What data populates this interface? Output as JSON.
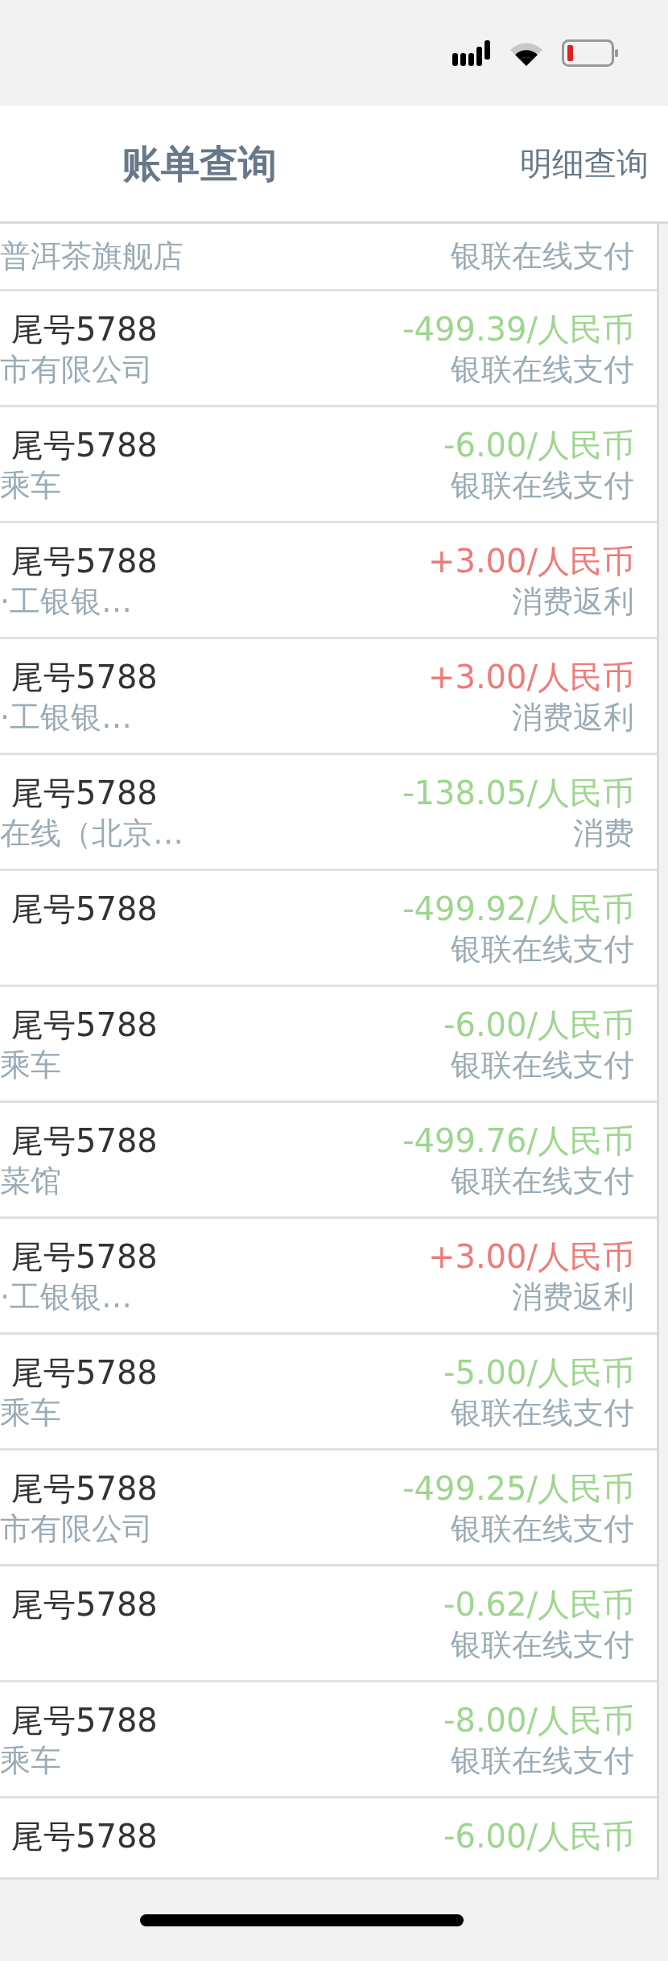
{
  "nav": {
    "title": "账单查询",
    "action": "明细查询"
  },
  "rows": [
    {
      "merchant": "普洱茶旗舰店",
      "type": "银联在线支付"
    },
    {
      "card": "尾号5788",
      "amount": "-499.39/人民币",
      "color": "#9dd68d",
      "merchant": "市有限公司",
      "type": "银联在线支付"
    },
    {
      "card": "尾号5788",
      "amount": "-6.00/人民币",
      "color": "#9dd68d",
      "merchant": "乘车",
      "type": "银联在线支付"
    },
    {
      "card": "尾号5788",
      "amount": "+3.00/人民币",
      "color": "#ee7b77",
      "merchant": "·工银银…",
      "type": "消费返利"
    },
    {
      "card": "尾号5788",
      "amount": "+3.00/人民币",
      "color": "#ee7b77",
      "merchant": "·工银银…",
      "type": "消费返利"
    },
    {
      "card": "尾号5788",
      "amount": "-138.05/人民币",
      "color": "#9dd68d",
      "merchant": "在线（北京…",
      "type": "消费"
    },
    {
      "card": "尾号5788",
      "amount": "-499.92/人民币",
      "color": "#9dd68d",
      "type": "银联在线支付"
    },
    {
      "card": "尾号5788",
      "amount": "-6.00/人民币",
      "color": "#9dd68d",
      "merchant": "乘车",
      "type": "银联在线支付"
    },
    {
      "card": "尾号5788",
      "amount": "-499.76/人民币",
      "color": "#9dd68d",
      "merchant": "菜馆",
      "type": "银联在线支付"
    },
    {
      "card": "尾号5788",
      "amount": "+3.00/人民币",
      "color": "#ee7b77",
      "merchant": "·工银银…",
      "type": "消费返利"
    },
    {
      "card": "尾号5788",
      "amount": "-5.00/人民币",
      "color": "#9dd68d",
      "merchant": "乘车",
      "type": "银联在线支付"
    },
    {
      "card": "尾号5788",
      "amount": "-499.25/人民币",
      "color": "#9dd68d",
      "merchant": "市有限公司",
      "type": "银联在线支付"
    },
    {
      "card": "尾号5788",
      "amount": "-0.62/人民币",
      "color": "#9dd68d",
      "type": "银联在线支付"
    },
    {
      "card": "尾号5788",
      "amount": "-8.00/人民币",
      "color": "#9dd68d",
      "merchant": "乘车",
      "type": "银联在线支付"
    },
    {
      "card": "尾号5788",
      "amount": "-6.00/人民币",
      "color": "#9dd68d"
    }
  ]
}
